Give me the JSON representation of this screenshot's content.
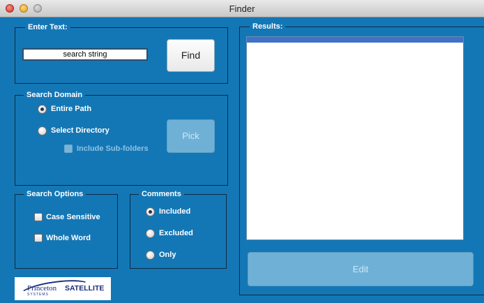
{
  "window": {
    "title": "Finder"
  },
  "enter_text": {
    "title": "Enter Text:",
    "search_value": "search string",
    "find_label": "Find"
  },
  "search_domain": {
    "title": "Search Domain",
    "entire_path": "Entire Path",
    "select_directory": "Select Directory",
    "include_subfolders": "Include Sub-folders",
    "pick_label": "Pick",
    "selected": "Entire Path"
  },
  "search_options": {
    "title": "Search Options",
    "case_sensitive": "Case Sensitive",
    "whole_word": "Whole Word"
  },
  "comments": {
    "title": "Comments",
    "included": "Included",
    "excluded": "Excluded",
    "only": "Only",
    "selected": "Included"
  },
  "results": {
    "title": "Results:",
    "edit_label": "Edit"
  },
  "logo": {
    "text_princeton": "Princeton",
    "text_satellite": "SATELLITE",
    "text_systems": "SYSTEMS"
  },
  "colors": {
    "background": "#1477b5",
    "disabled_button": "#6fb1d6",
    "selection": "#3f72c6"
  }
}
